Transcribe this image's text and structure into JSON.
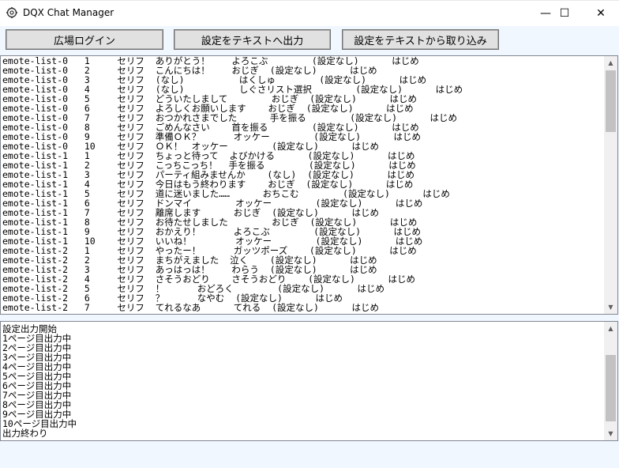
{
  "window": {
    "title": "DQX Chat Manager",
    "controls": {
      "minimize": "—",
      "maximize": "☐",
      "close": "✕"
    }
  },
  "toolbar": {
    "login_label": "広場ログイン",
    "export_label": "設定をテキストへ出力",
    "import_label": "設定をテキストから取り込み"
  },
  "emote_list": {
    "rows": [
      "emote-list-0   1     セリフ  ありがとう！    よろこぶ        (設定なし)      はじめ",
      "emote-list-0   2     セリフ  こんにちは！    おじぎ  (設定なし)      はじめ",
      "emote-list-0   3     セリフ  (なし)          はくしゅ        (設定なし)      はじめ",
      "emote-list-0   4     セリフ  (なし)          しぐさリスト選択        (設定なし)      はじめ",
      "emote-list-0   5     セリフ  どういたしまして        おじぎ  (設定なし)      はじめ",
      "emote-list-0   6     セリフ  よろしくお願いします    おじぎ  (設定なし)      はじめ",
      "emote-list-0   7     セリフ  おつかれさまでした      手を振る        (設定なし)      はじめ",
      "emote-list-0   8     セリフ  ごめんなさい    首を振る        (設定なし)      はじめ",
      "emote-list-0   9     セリフ  準備ＯＫ？      オッケー        (設定なし)      はじめ",
      "emote-list-0   10    セリフ  ＯＫ！　オッケー        (設定なし)      はじめ",
      "emote-list-1   1     セリフ  ちょっと待って  よびかける      (設定なし)      はじめ",
      "emote-list-1   2     セリフ  こっちこっち！  手を振る        (設定なし)      はじめ",
      "emote-list-1   3     セリフ  パーティ組みませんか    (なし)  (設定なし)      はじめ",
      "emote-list-1   4     セリフ  今日はもう終わります    おじぎ  (設定なし)      はじめ",
      "emote-list-1   5     セリフ  道に迷いました……      おちこむ        (設定なし)      はじめ",
      "emote-list-1   6     セリフ  ドンマイ        オッケー        (設定なし)      はじめ",
      "emote-list-1   7     セリフ  離席します      おじぎ  (設定なし)      はじめ",
      "emote-list-1   8     セリフ  お待たせしました        おじぎ  (設定なし)      はじめ",
      "emote-list-1   9     セリフ  おかえり！      よろこぶ        (設定なし)      はじめ",
      "emote-list-1   10    セリフ  いいね！        オッケー        (設定なし)      はじめ",
      "emote-list-2   1     セリフ  やったー！      ガッツポーズ    (設定なし)      はじめ",
      "emote-list-2   2     セリフ  まちがえました  泣く    (設定なし)      はじめ",
      "emote-list-2   3     セリフ  あっはっは！    わらう  (設定なし)      はじめ",
      "emote-list-2   4     セリフ  さそうおどり    さそうおどり    (設定なし)      はじめ",
      "emote-list-2   5     セリフ  ！      おどろく        (設定なし)      はじめ",
      "emote-list-2   6     セリフ  ？      なやむ  (設定なし)      はじめ",
      "emote-list-2   7     セリフ  てれるなあ      てれる  (設定なし)      はじめ"
    ]
  },
  "log": {
    "lines": [
      "設定出力開始",
      "1ページ目出力中",
      "2ページ目出力中",
      "3ページ目出力中",
      "4ページ目出力中",
      "5ページ目出力中",
      "6ページ目出力中",
      "7ページ目出力中",
      "8ページ目出力中",
      "9ページ目出力中",
      "10ページ目出力中",
      "出力終わり"
    ]
  },
  "icons": {
    "app": "gear-icon",
    "scroll_up": "chevron-up-icon",
    "scroll_down": "chevron-down-icon"
  }
}
